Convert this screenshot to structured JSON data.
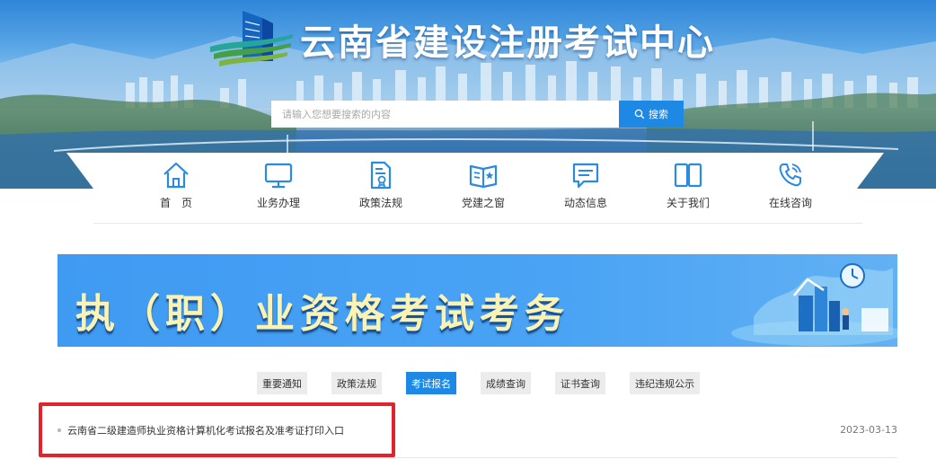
{
  "header": {
    "site_title": "云南省建设注册考试中心",
    "logo_icon": "building-logo-icon"
  },
  "search": {
    "placeholder": "请输入您想要搜索的内容",
    "value": "",
    "button_label": "搜索",
    "button_icon": "search-icon"
  },
  "nav": {
    "items": [
      {
        "label": "首　页",
        "icon": "home-icon"
      },
      {
        "label": "业务办理",
        "icon": "monitor-icon"
      },
      {
        "label": "政策法规",
        "icon": "document-seal-icon"
      },
      {
        "label": "党建之窗",
        "icon": "open-book-star-icon"
      },
      {
        "label": "动态信息",
        "icon": "chat-bubble-icon"
      },
      {
        "label": "关于我们",
        "icon": "book-panels-icon"
      },
      {
        "label": "在线咨询",
        "icon": "phone-call-icon"
      }
    ]
  },
  "banner": {
    "title": "执（职）业资格考试考务"
  },
  "tabs": {
    "items": [
      {
        "label": "重要通知",
        "active": false
      },
      {
        "label": "政策法规",
        "active": false
      },
      {
        "label": "考试报名",
        "active": true
      },
      {
        "label": "成绩查询",
        "active": false
      },
      {
        "label": "证书查询",
        "active": false
      },
      {
        "label": "违纪违规公示",
        "active": false
      }
    ]
  },
  "list": {
    "items": [
      {
        "title": "云南省二级建造师执业资格计算机化考试报名及准考证打印入口",
        "date": "2023-03-13"
      }
    ]
  },
  "colors": {
    "primary_blue": "#1e88e5",
    "icon_blue": "#2a8ae0",
    "highlight_red": "#e0232d",
    "banner_text": "#fbf3b4"
  }
}
